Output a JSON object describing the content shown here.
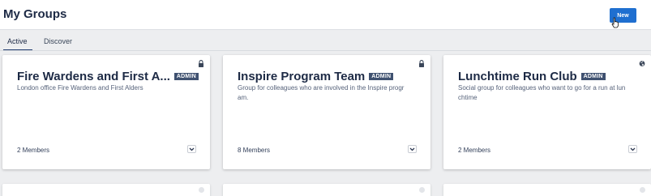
{
  "header": {
    "title": "My Groups",
    "new_button_label": "New"
  },
  "tabs": [
    {
      "label": "Active",
      "selected": true
    },
    {
      "label": "Discover",
      "selected": false
    }
  ],
  "groups": [
    {
      "name": "Fire Wardens and First A...",
      "badge": "ADMIN",
      "description": "London office Fire Wardens and First Alders",
      "members": "2 Members",
      "visibility_icon": "lock-icon"
    },
    {
      "name": "Inspire Program Team",
      "badge": "ADMIN",
      "description": "Group for colleagues who are involved in the Inspire progr am.",
      "members": "8 Members",
      "visibility_icon": "lock-icon"
    },
    {
      "name": "Lunchtime Run Club",
      "badge": "ADMIN",
      "description": "Social group for colleagues who want to go for a run at lun chtime",
      "members": "2 Members",
      "visibility_icon": "globe-icon"
    }
  ],
  "colors": {
    "primary": "#1f6fd0",
    "badge_bg": "#3f5170",
    "background": "#edeef0"
  }
}
